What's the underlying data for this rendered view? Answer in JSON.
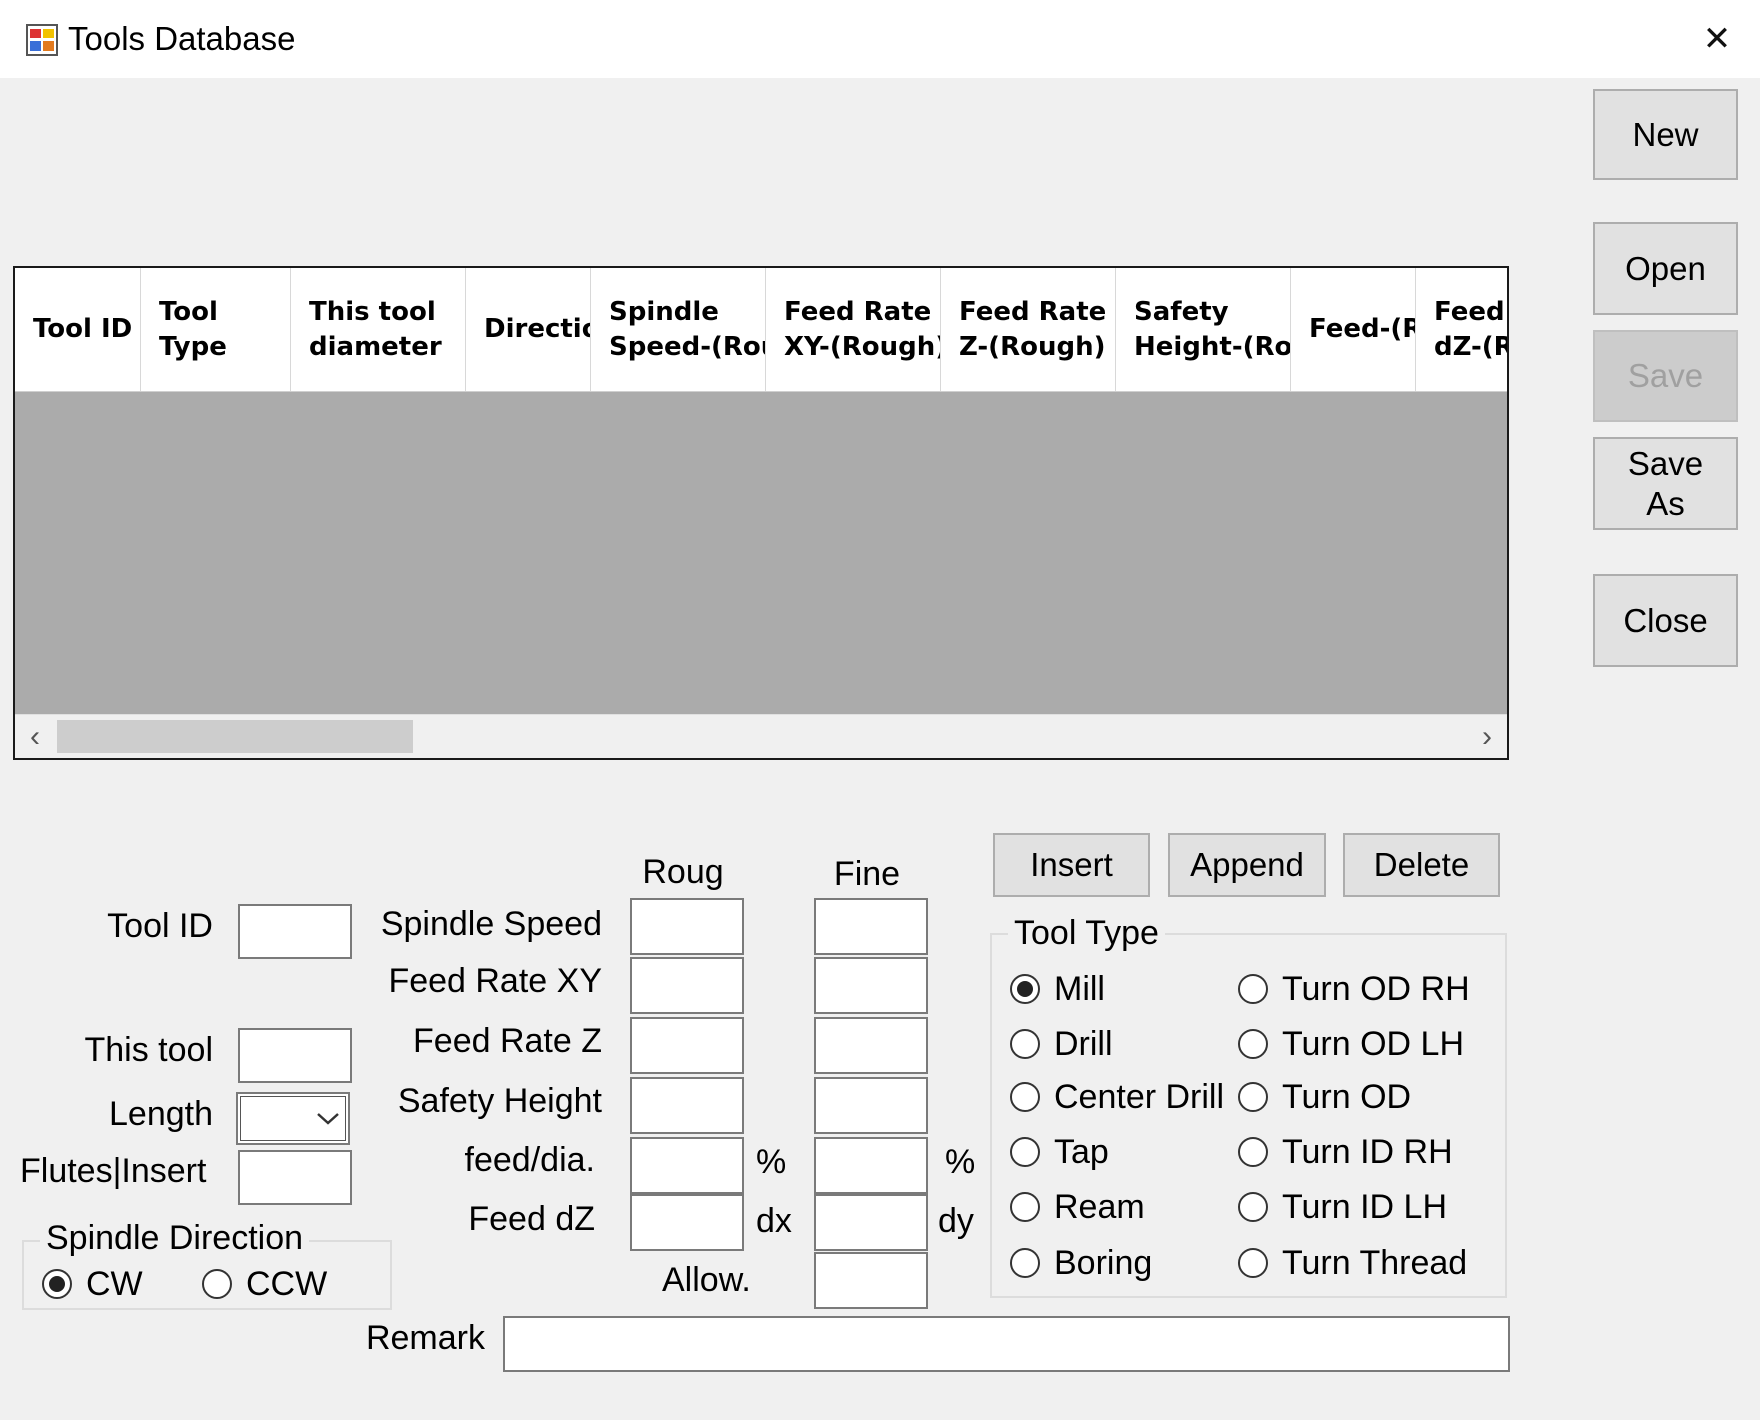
{
  "window": {
    "title": "Tools Database",
    "close_glyph": "✕",
    "icon": "database-app-icon"
  },
  "side_buttons": {
    "new": "New",
    "open": "Open",
    "save": "Save",
    "save_as": "Save\nAs",
    "close": "Close"
  },
  "grid": {
    "columns": [
      "Tool ID",
      "Tool\nType",
      "This tool\ndiameter",
      "Directio",
      "Spindle\nSpeed-(Rou",
      "Feed Rate\nXY-(Rough)",
      "Feed Rate\nZ-(Rough)",
      "Safety\nHeight-(Rou",
      "Feed-(R",
      "Feed\ndZ-(R"
    ],
    "rows": [],
    "scroll_left": "‹",
    "scroll_right": "›"
  },
  "form": {
    "tool_id_label": "Tool ID",
    "tool_id_value": "",
    "this_tool_label": "This tool",
    "this_tool_value": "",
    "length_label": "Length",
    "length_value": "",
    "flutes_label": "Flutes|Insert",
    "flutes_value": "",
    "rough_header": "Roug",
    "fine_header": "Fine",
    "spindle_speed_label": "Spindle Speed",
    "feed_rate_xy_label": "Feed Rate XY",
    "feed_rate_z_label": "Feed Rate Z",
    "safety_height_label": "Safety Height",
    "feed_dia_label": "feed/dia.",
    "feed_dz_label": "Feed dZ",
    "allow_label": "Allow.",
    "percent_rough": "%",
    "percent_fine": "%",
    "dx_label": "dx",
    "dy_label": "dy",
    "remark_label": "Remark",
    "remark_value": ""
  },
  "spindle_direction": {
    "legend": "Spindle Direction",
    "options": [
      "CW",
      "CCW"
    ],
    "selected": "CW"
  },
  "actions": {
    "insert": "Insert",
    "append": "Append",
    "delete": "Delete"
  },
  "tool_type": {
    "legend": "Tool Type",
    "options_left": [
      "Mill",
      "Drill",
      "Center Drill",
      "Tap",
      "Ream",
      "Boring"
    ],
    "options_right": [
      "Turn OD RH",
      "Turn OD LH",
      "Turn OD",
      "Turn ID RH",
      "Turn ID LH",
      "Turn Thread"
    ],
    "selected": "Mill"
  },
  "colors": {
    "window_bg": "#f0f0f0",
    "grid_bg": "#ababab",
    "button_bg": "#e1e1e1",
    "disabled_text": "#a0a0a0"
  }
}
